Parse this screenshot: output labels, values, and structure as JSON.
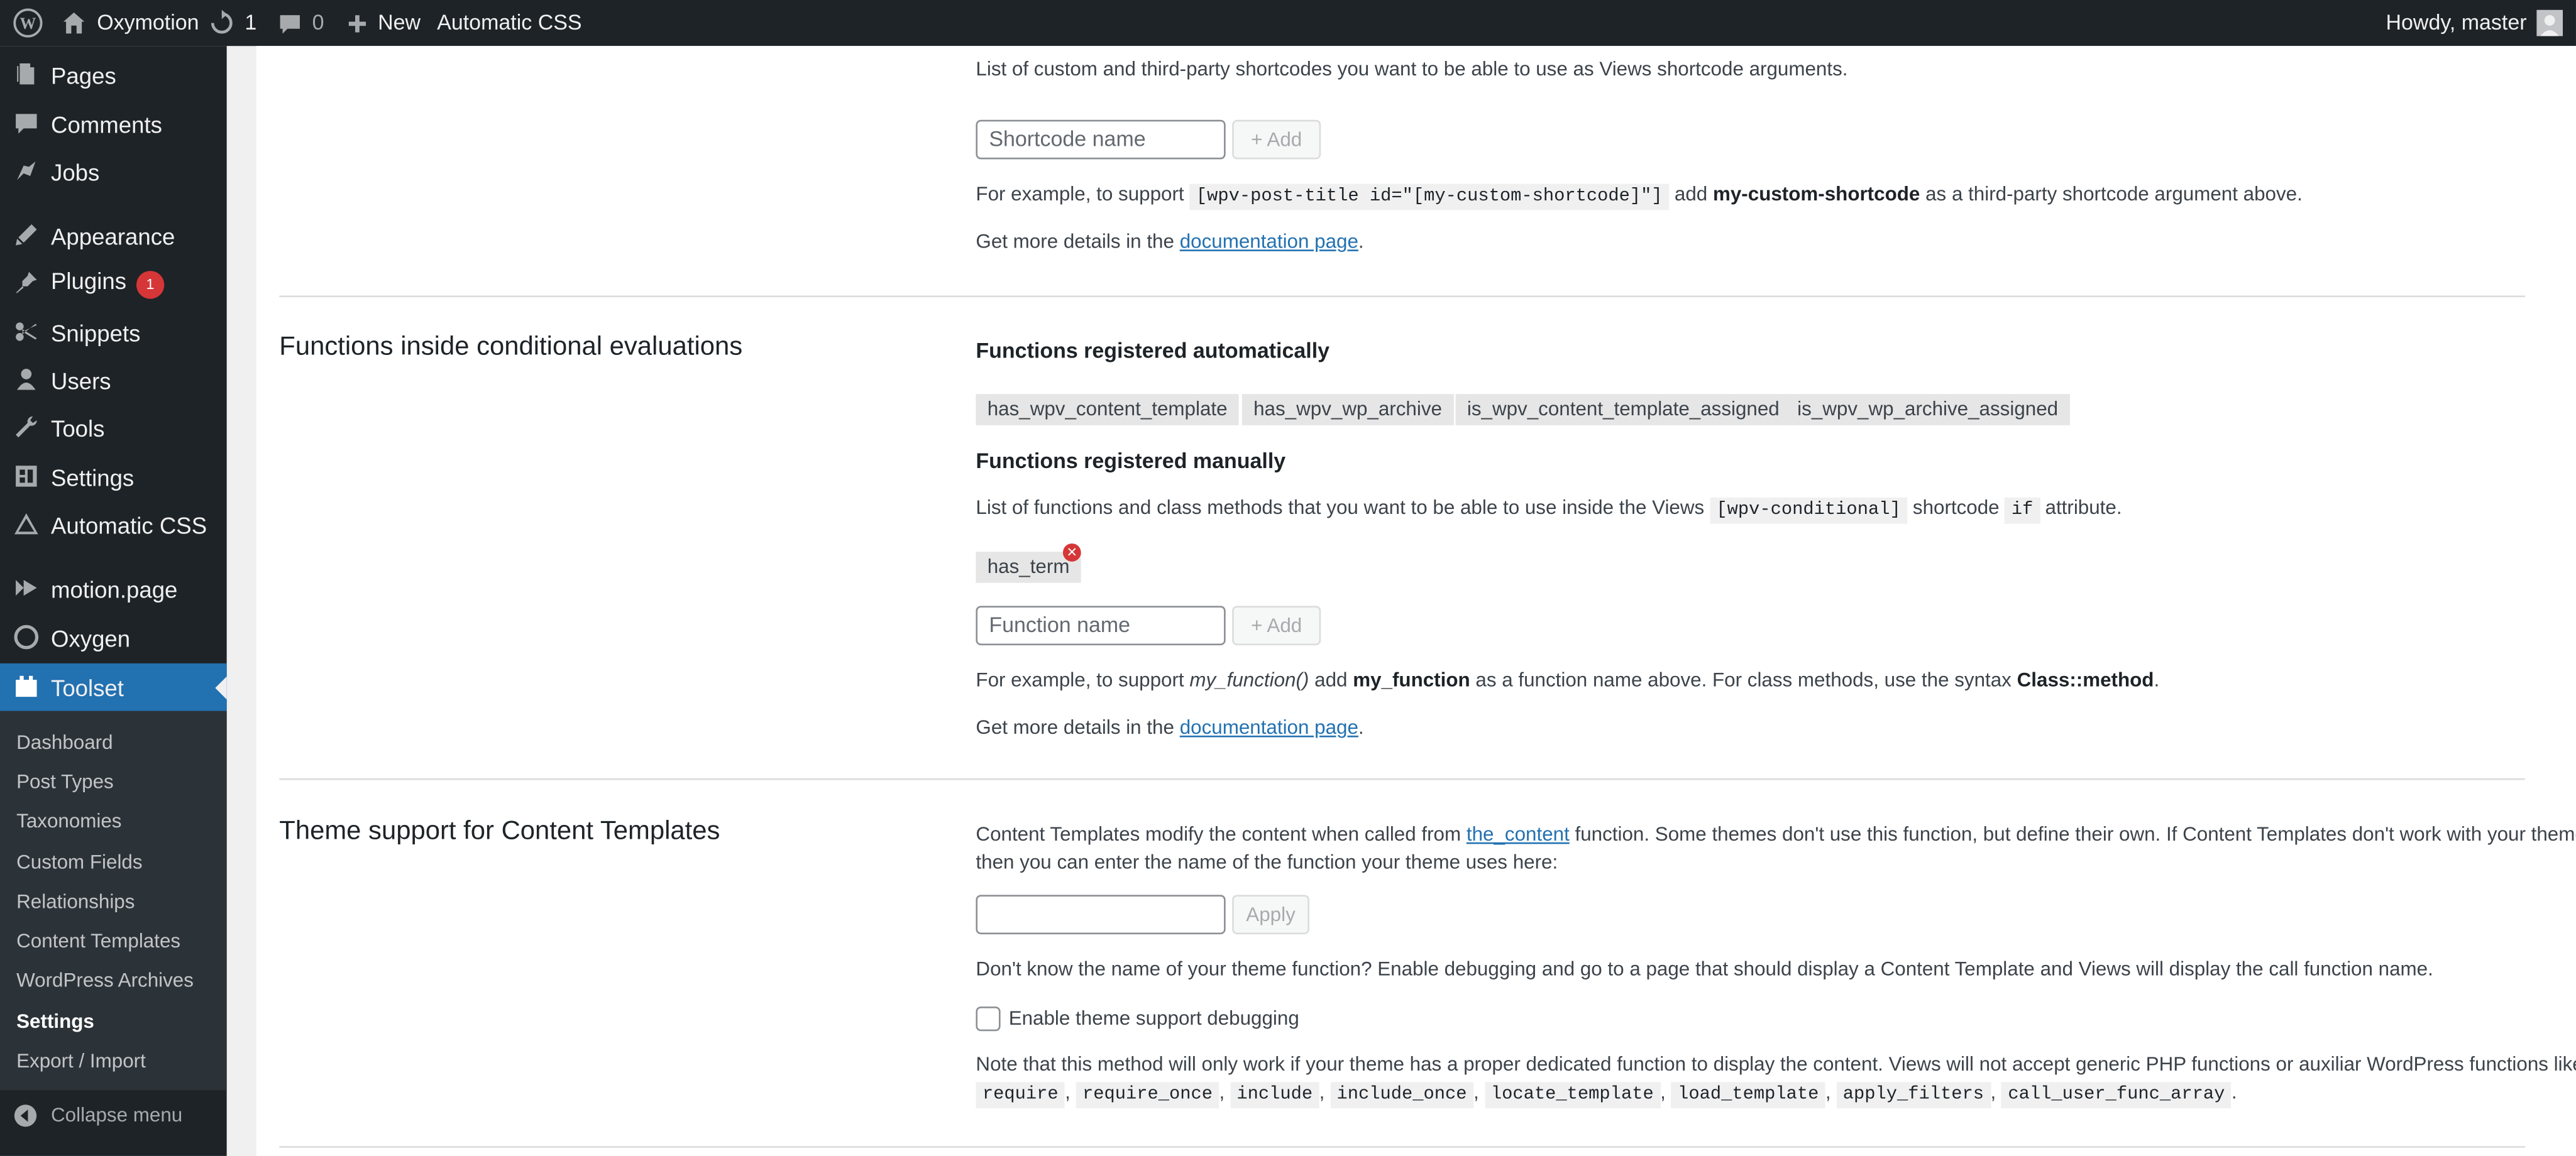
{
  "adminbar": {
    "wp_logo_icon": "wordpress-icon",
    "site_name": "Oxymotion",
    "updates_count": "1",
    "comments_count": "0",
    "new_label": "New",
    "plugin_link": "Automatic CSS",
    "greeting": "Howdy, master"
  },
  "sidebar": {
    "items": [
      {
        "label": "Pages",
        "icon": "pages-icon"
      },
      {
        "label": "Comments",
        "icon": "comments-icon"
      },
      {
        "label": "Jobs",
        "icon": "jobs-icon"
      },
      {
        "label": "Appearance",
        "icon": "appearance-icon"
      },
      {
        "label": "Plugins",
        "icon": "plugins-icon",
        "badge": "1"
      },
      {
        "label": "Snippets",
        "icon": "snippets-icon"
      },
      {
        "label": "Users",
        "icon": "users-icon"
      },
      {
        "label": "Tools",
        "icon": "tools-icon"
      },
      {
        "label": "Settings",
        "icon": "settings-icon"
      },
      {
        "label": "Automatic CSS",
        "icon": "automatic-css-icon"
      },
      {
        "label": "motion.page",
        "icon": "motion-page-icon"
      },
      {
        "label": "Oxygen",
        "icon": "oxygen-icon"
      },
      {
        "label": "Toolset",
        "icon": "toolset-icon"
      }
    ],
    "submenu": [
      "Dashboard",
      "Post Types",
      "Taxonomies",
      "Custom Fields",
      "Relationships",
      "Content Templates",
      "WordPress Archives",
      "Settings",
      "Export / Import"
    ],
    "collapse_label": "Collapse menu"
  },
  "shortcodes": {
    "description": "List of custom and third-party shortcodes you want to be able to use as Views shortcode arguments.",
    "input_placeholder": "Shortcode name",
    "add_label": "Add",
    "example_pre": "For example, to support",
    "example_code": "[wpv-post-title id=\"[my-custom-shortcode]\"]",
    "example_mid": "add",
    "example_bold": "my-custom-shortcode",
    "example_post": "as a third-party shortcode argument above.",
    "details_pre": "Get more details in the",
    "details_link": "documentation page",
    "details_post": "."
  },
  "functions": {
    "title": "Functions inside conditional evaluations",
    "auto_heading": "Functions registered automatically",
    "auto_list": [
      "has_wpv_content_template",
      "has_wpv_wp_archive",
      "is_wpv_content_template_assigned",
      "is_wpv_wp_archive_assigned"
    ],
    "manual_heading": "Functions registered manually",
    "manual_desc_pre": "List of functions and class methods that you want to be able to use inside the Views",
    "manual_desc_code1": "[wpv-conditional]",
    "manual_desc_mid": "shortcode",
    "manual_desc_code2": "if",
    "manual_desc_post": "attribute.",
    "manual_list": [
      "has_term"
    ],
    "input_placeholder": "Function name",
    "add_label": "Add",
    "example_pre": "For example, to support",
    "example_italic": "my_function()",
    "example_mid": "add",
    "example_bold": "my_function",
    "example_mid2": "as a function name above. For class methods, use the syntax",
    "example_bold2": "Class::method",
    "example_post": ".",
    "details_pre": "Get more details in the",
    "details_link": "documentation page",
    "details_post": "."
  },
  "theme_support": {
    "title": "Theme support for Content Templates",
    "desc1_pre": "Content Templates modify the content when called from",
    "desc1_link": "the_content",
    "desc1_post": "function. Some themes don't use this function, but define their own. If Content Templates don't work with your theme",
    "desc2": "then you can enter the name of the function your theme uses here:",
    "input_value": "",
    "apply_label": "Apply",
    "debug_hint": "Don't know the name of your theme function? Enable debugging and go to a page that should display a Content Template and Views will display the call function name.",
    "checkbox_label": "Enable theme support debugging",
    "note": "Note that this method will only work if your theme has a proper dedicated function to display the content. Views will not accept generic PHP functions or auxiliar WordPress functions like",
    "note_functions": [
      "require",
      "require_once",
      "include",
      "include_once",
      "locate_template",
      "load_template",
      "apply_filters",
      "call_user_func_array"
    ],
    "note_end": "."
  }
}
